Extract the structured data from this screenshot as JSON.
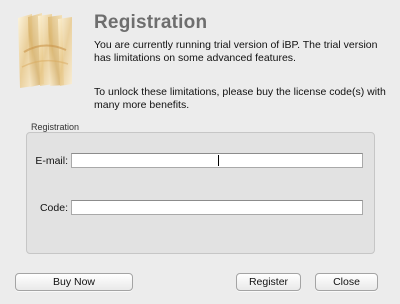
{
  "dialog": {
    "title": "Registration",
    "description": "You are currently running trial version of  iBP. The trial version has limitations on some advanced features.",
    "unlock_text": "To unlock these limitations, please buy the license code(s) with many more benefits."
  },
  "registration_group": {
    "label": "Registration",
    "email_label": "E-mail:",
    "email_value": "",
    "code_label": "Code:",
    "code_value": ""
  },
  "buttons": {
    "buy_now": "Buy Now",
    "register": "Register",
    "close": "Close"
  },
  "icons": {
    "app_logo": "ibp-logo-icon"
  }
}
